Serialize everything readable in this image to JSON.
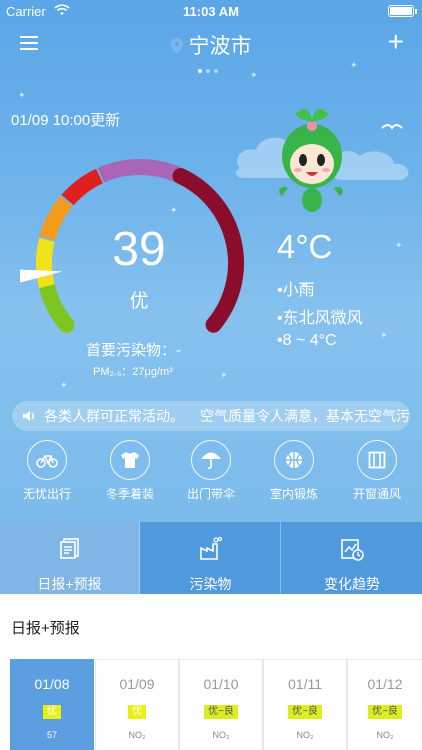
{
  "status_bar": {
    "carrier": "Carrier",
    "time": "11:03 AM"
  },
  "nav": {
    "city": "宁波市"
  },
  "update_time": "01/09 10:00更新",
  "aqi": {
    "value": "39",
    "level": "优",
    "primary_pollutant": "首要污染物：-",
    "pm25": "PM₂.₅：27μg/m³",
    "level_fraction": 0.13
  },
  "weather": {
    "temperature": "4°C",
    "condition": "•小雨",
    "wind": "•东北风微风",
    "range": "•8 ~ 4°C"
  },
  "ticker": {
    "text1": "各类人群可正常活动。",
    "text2": "空气质量令人满意，基本无空气污染"
  },
  "tips": [
    {
      "label": "无忧出行",
      "icon": "bicycle-icon"
    },
    {
      "label": "冬季着装",
      "icon": "shirt-icon"
    },
    {
      "label": "出门带伞",
      "icon": "umbrella-icon"
    },
    {
      "label": "室内锻炼",
      "icon": "basketball-icon"
    },
    {
      "label": "开窗通风",
      "icon": "window-icon"
    }
  ],
  "tabs": [
    {
      "label": "日报+预报",
      "icon": "report-icon"
    },
    {
      "label": "污染物",
      "icon": "factory-icon"
    },
    {
      "label": "变化趋势",
      "icon": "trend-icon"
    }
  ],
  "section_title": "日报+预报",
  "days": [
    {
      "date": "01/08",
      "level": "优",
      "pollutant": "57"
    },
    {
      "date": "01/09",
      "level": "优",
      "pollutant": "NO₂"
    },
    {
      "date": "01/10",
      "level": "优~良",
      "pollutant": "NO₂"
    },
    {
      "date": "01/11",
      "level": "优~良",
      "pollutant": "NO₂"
    },
    {
      "date": "01/12",
      "level": "优~良",
      "pollutant": "NO₂"
    }
  ],
  "colors": {
    "accent": "#5b9fe0",
    "level_good": "#e8f016"
  }
}
